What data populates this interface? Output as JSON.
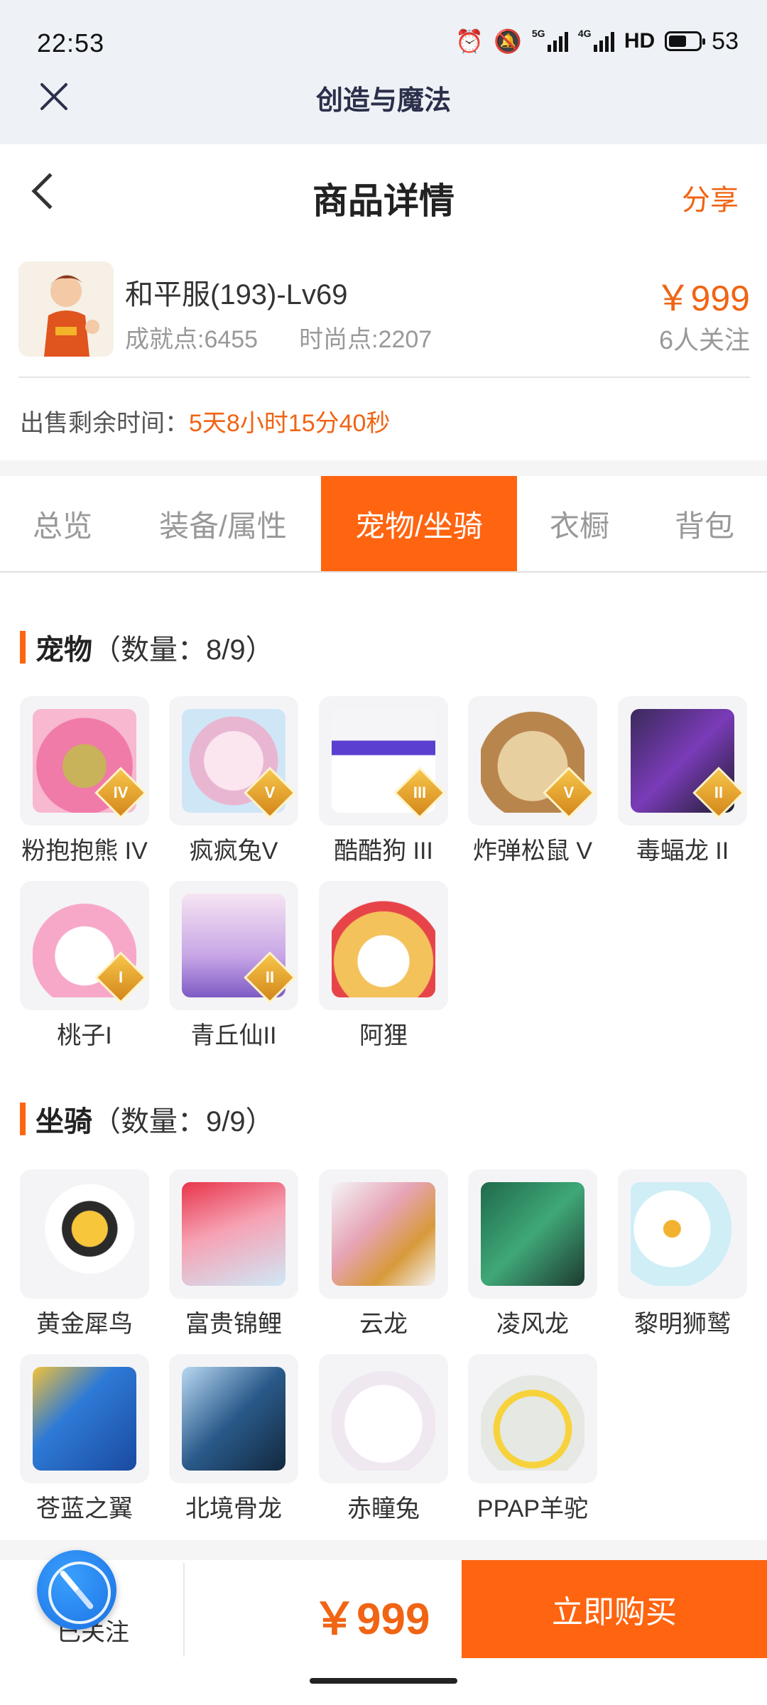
{
  "status_bar": {
    "time": "22:53",
    "signal1_label": "5G",
    "signal2_label": "4G",
    "hd_label": "HD",
    "battery_value": "53"
  },
  "webview": {
    "title": "创造与魔法"
  },
  "header": {
    "title": "商品详情",
    "share_label": "分享"
  },
  "product": {
    "name": "和平服(193)-Lv69",
    "achievement": "成就点:6455",
    "fashion": "时尚点:2207",
    "price": "￥999",
    "followers": "6人关注",
    "remaining_label": "出售剩余时间：",
    "remaining_value": "5天8小时15分40秒"
  },
  "tabs": [
    {
      "label": "总览"
    },
    {
      "label": "装备/属性"
    },
    {
      "label": "宠物/坐骑",
      "active": true
    },
    {
      "label": "衣橱"
    },
    {
      "label": "背包"
    }
  ],
  "pets": {
    "title": "宠物",
    "count": "（数量：8/9）",
    "items": [
      {
        "name": "粉抱抱熊 IV",
        "badge": "IV"
      },
      {
        "name": "疯疯兔V",
        "badge": "V"
      },
      {
        "name": "酷酷狗 III",
        "badge": "III"
      },
      {
        "name": "炸弹松鼠 V",
        "badge": "V"
      },
      {
        "name": "毒蝠龙 II",
        "badge": "II"
      },
      {
        "name": "桃子I",
        "badge": "I"
      },
      {
        "name": "青丘仙II",
        "badge": "II"
      },
      {
        "name": "阿狸",
        "badge": ""
      }
    ]
  },
  "mounts": {
    "title": "坐骑",
    "count": "（数量：9/9）",
    "items": [
      {
        "name": "黄金犀鸟"
      },
      {
        "name": "富贵锦鲤"
      },
      {
        "name": "云龙"
      },
      {
        "name": "凌风龙"
      },
      {
        "name": "黎明狮鹫"
      },
      {
        "name": "苍蓝之翼"
      },
      {
        "name": "北境骨龙"
      },
      {
        "name": "赤瞳兔"
      },
      {
        "name": "PPAP羊驼"
      }
    ]
  },
  "bottom": {
    "followed_label": "已关注",
    "price": "￥999",
    "buy_label": "立即购买"
  },
  "colors": {
    "accent": "#ff6410",
    "price": "#f06414"
  }
}
